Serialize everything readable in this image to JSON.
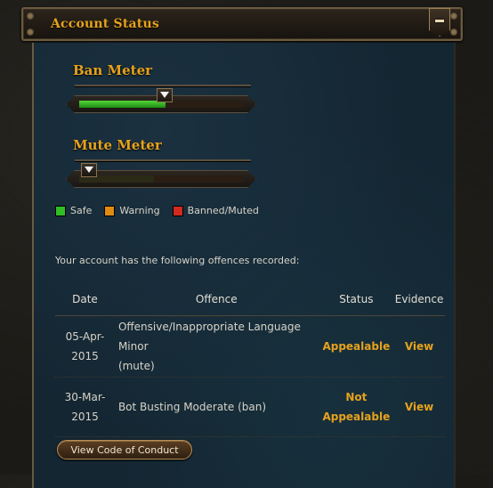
{
  "panel": {
    "title": "Account Status"
  },
  "ban_meter": {
    "title": "Ban Meter",
    "level": 0.52
  },
  "mute_meter": {
    "title": "Mute Meter",
    "level": 0.0
  },
  "legend": [
    {
      "label": "Safe",
      "color": "#2fbf24"
    },
    {
      "label": "Warning",
      "color": "#e08a12"
    },
    {
      "label": "Banned/Muted",
      "color": "#d12a1f"
    }
  ],
  "offences": {
    "intro": "Your account has the following offences recorded:",
    "headers": {
      "date": "Date",
      "offence": "Offence",
      "status": "Status",
      "evidence": "Evidence"
    },
    "rows": [
      {
        "date_l1": "05-Apr-",
        "date_l2": "2015",
        "offence_l1": "Offensive/Inappropriate Language Minor",
        "offence_l2": "(mute)",
        "status_l1": "Appealable",
        "status_l2": "",
        "evidence": "View"
      },
      {
        "date_l1": "30-Mar-",
        "date_l2": "2015",
        "offence_l1": "Bot Busting Moderate (ban)",
        "offence_l2": "",
        "status_l1": "Not",
        "status_l2": "Appealable",
        "evidence": "View"
      }
    ]
  },
  "conduct_button": "View Code of Conduct"
}
